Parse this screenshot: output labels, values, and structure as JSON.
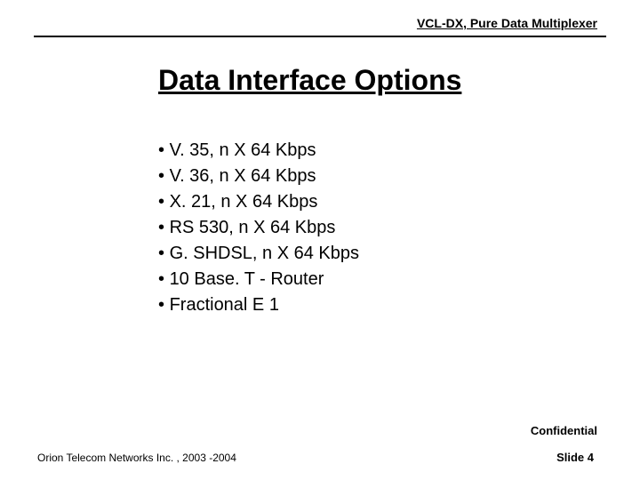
{
  "header": {
    "label": "VCL-DX, Pure Data Multiplexer"
  },
  "title": "Data Interface Options",
  "bullets": [
    "V. 35, n X 64 Kbps",
    "V. 36, n X 64 Kbps",
    "X. 21, n X 64 Kbps",
    "RS 530, n X 64 Kbps",
    "G. SHDSL, n X 64 Kbps",
    "10 Base. T - Router",
    "Fractional E 1"
  ],
  "footer": {
    "confidential": "Confidential",
    "org": "Orion Telecom Networks Inc. , 2003 -2004",
    "slide": "Slide 4"
  }
}
